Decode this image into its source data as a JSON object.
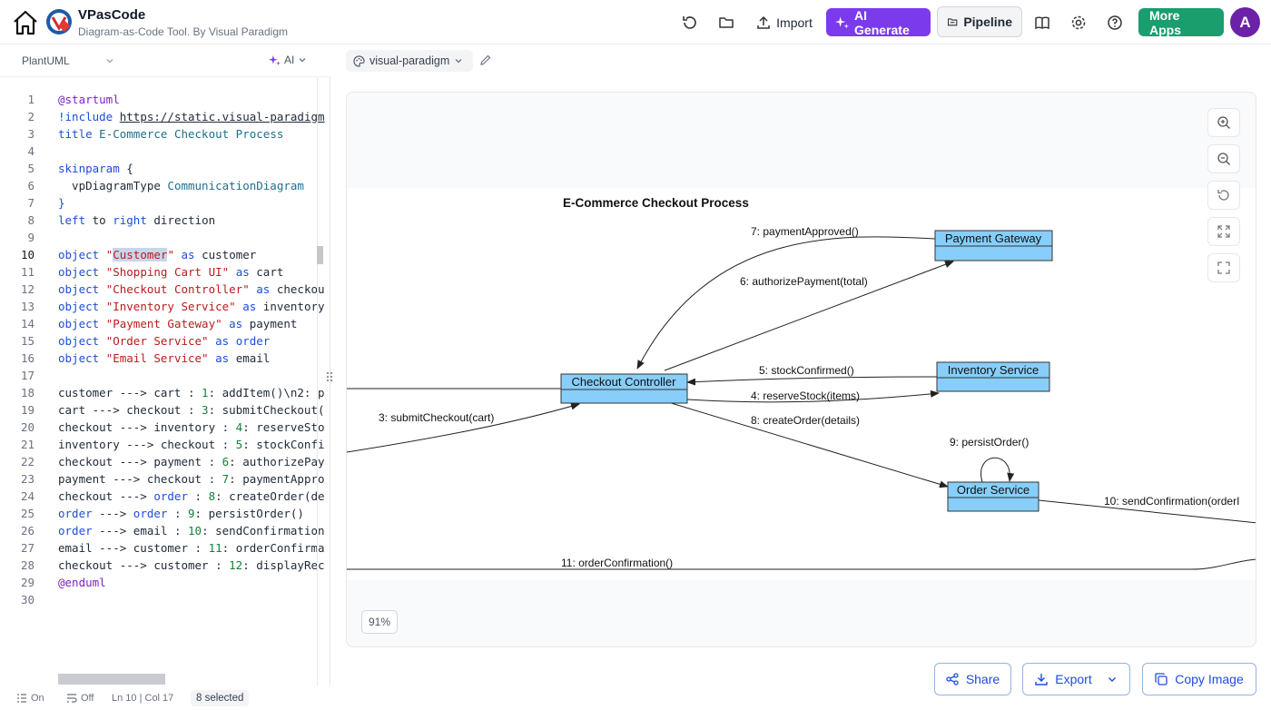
{
  "header": {
    "app_title": "VPasCode",
    "app_subtitle": "Diagram-as-Code Tool. By Visual Paradigm",
    "import_label": "Import",
    "ai_generate_label": "AI Generate",
    "pipeline_label": "Pipeline",
    "more_apps_label": "More Apps",
    "avatar_initial": "A"
  },
  "editor": {
    "language": "PlantUML",
    "ai_label": "AI",
    "active_line": 10,
    "lines": [
      "@startuml",
      "!include https://static.visual-paradigm",
      "title E-Commerce Checkout Process",
      "",
      "skinparam {",
      "  vpDiagramType CommunicationDiagram",
      "}",
      "left to right direction",
      "",
      "object \"Customer\" as customer",
      "object \"Shopping Cart UI\" as cart",
      "object \"Checkout Controller\" as checkou",
      "object \"Inventory Service\" as inventory",
      "object \"Payment Gateway\" as payment",
      "object \"Order Service\" as order",
      "object \"Email Service\" as email",
      "",
      "customer ---> cart : 1: addItem()\\n2: p",
      "cart ---> checkout : 3: submitCheckout(",
      "checkout ---> inventory : 4: reserveSto",
      "inventory ---> checkout : 5: stockConfi",
      "checkout ---> payment : 6: authorizePay",
      "payment ---> checkout : 7: paymentAppro",
      "checkout ---> order : 8: createOrder(de",
      "order ---> order : 9: persistOrder()",
      "order ---> email : 10: sendConfirmation",
      "email ---> customer : 11: orderConfirma",
      "checkout ---> customer : 12: displayRec",
      "@enduml",
      ""
    ]
  },
  "status_bar": {
    "wrap_label": "On",
    "minimap_label": "Off",
    "cursor_position": "Ln 10 | Col 17",
    "selection": "8 selected"
  },
  "preview": {
    "theme": "visual-paradigm",
    "zoom": "91%",
    "diagram": {
      "title": "E-Commerce Checkout Process",
      "objects": [
        "Payment Gateway",
        "Checkout Controller",
        "Inventory Service",
        "Order Service"
      ],
      "messages": [
        "7: paymentApproved()",
        "6: authorizePayment(total)",
        "5: stockConfirmed()",
        "4: reserveStock(items)",
        "3: submitCheckout(cart)",
        "8: createOrder(details)",
        "9: persistOrder()",
        "10: sendConfirmation(orderI",
        "11: orderConfirmation()"
      ]
    }
  },
  "actions": {
    "share_label": "Share",
    "export_label": "Export",
    "copy_image_label": "Copy Image"
  },
  "colors": {
    "accent_ai": "#7c3aed",
    "more_apps": "#1a9e6e",
    "object_fill": "#87cefa"
  }
}
